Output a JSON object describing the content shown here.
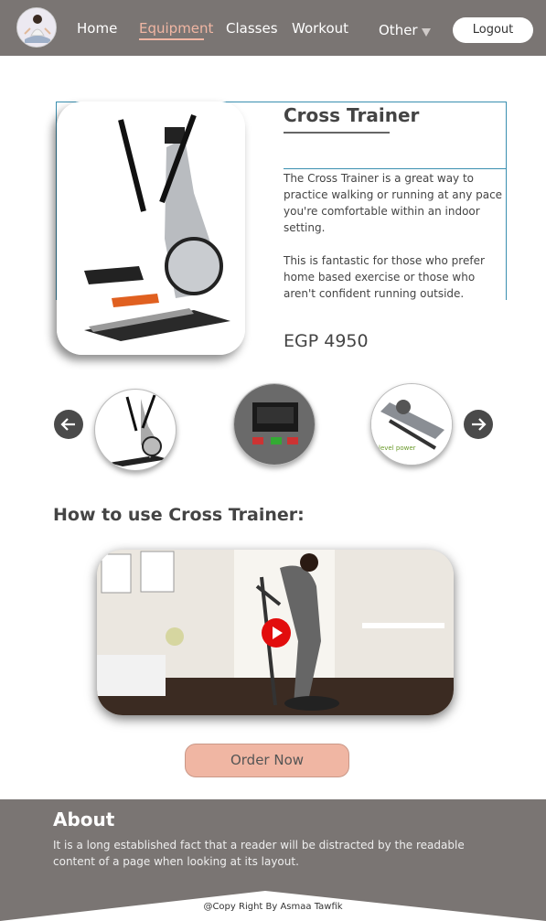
{
  "nav": {
    "items": [
      "Home",
      "Equipment",
      "Classes",
      "Workout",
      "Other"
    ],
    "logout_label": "Logout"
  },
  "product": {
    "title": "Cross Trainer",
    "description_1": "The Cross Trainer is a great way to practice walking or running at any pace you're comfortable within an indoor setting.",
    "description_2": "This is fantastic for those who prefer home based exercise or those who aren't confident running outside.",
    "price": "EGP 4950"
  },
  "thumb_text": "level power",
  "howto_title": "How to use Cross Trainer:",
  "order_label": "Order Now",
  "footer": {
    "about_title": "About",
    "about_text": "It is a long established fact that a reader will be distracted by the readable content of a page when looking at its layout.",
    "copyright": "@Copy Right By Asmaa Tawfik"
  },
  "colors": {
    "nav_bg": "#7a7573",
    "accent": "#f0b6a3",
    "footer_bg": "#7a7573"
  }
}
